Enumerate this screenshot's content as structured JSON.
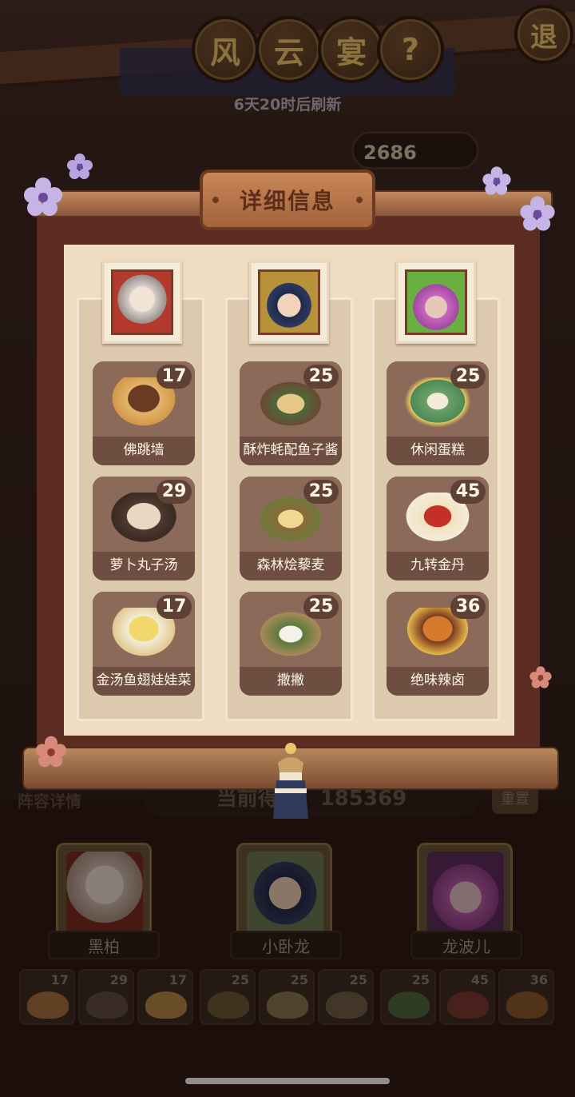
{
  "header": {
    "title_chars": [
      "风",
      "云",
      "宴"
    ],
    "help_label": "?",
    "exit_label": "退",
    "refresh_text": "6天20时后刷新",
    "score_partial": "2686"
  },
  "background": {
    "lineup_label": "阵容详情",
    "current_score": "当前得分：185369",
    "reset_label": "重置"
  },
  "panel": {
    "title": "详细信息",
    "columns": [
      {
        "character": "黑柏",
        "dishes": [
          {
            "name": "佛跳墙",
            "score": "17"
          },
          {
            "name": "萝卜丸子汤",
            "score": "29"
          },
          {
            "name": "金汤鱼翅娃娃菜",
            "score": "17"
          }
        ]
      },
      {
        "character": "小卧龙",
        "dishes": [
          {
            "name": "酥炸蚝配鱼子酱",
            "score": "25"
          },
          {
            "name": "森林烩藜麦",
            "score": "25"
          },
          {
            "name": "撒撇",
            "score": "25"
          }
        ]
      },
      {
        "character": "龙波儿",
        "dishes": [
          {
            "name": "休闲蛋糕",
            "score": "25"
          },
          {
            "name": "九转金丹",
            "score": "45"
          },
          {
            "name": "绝味辣卤",
            "score": "36"
          }
        ]
      }
    ]
  },
  "bottom": {
    "characters": [
      "黑柏",
      "小卧龙",
      "龙波儿"
    ],
    "slot_scores": [
      "17",
      "29",
      "17",
      "25",
      "25",
      "25",
      "25",
      "45",
      "36"
    ]
  }
}
